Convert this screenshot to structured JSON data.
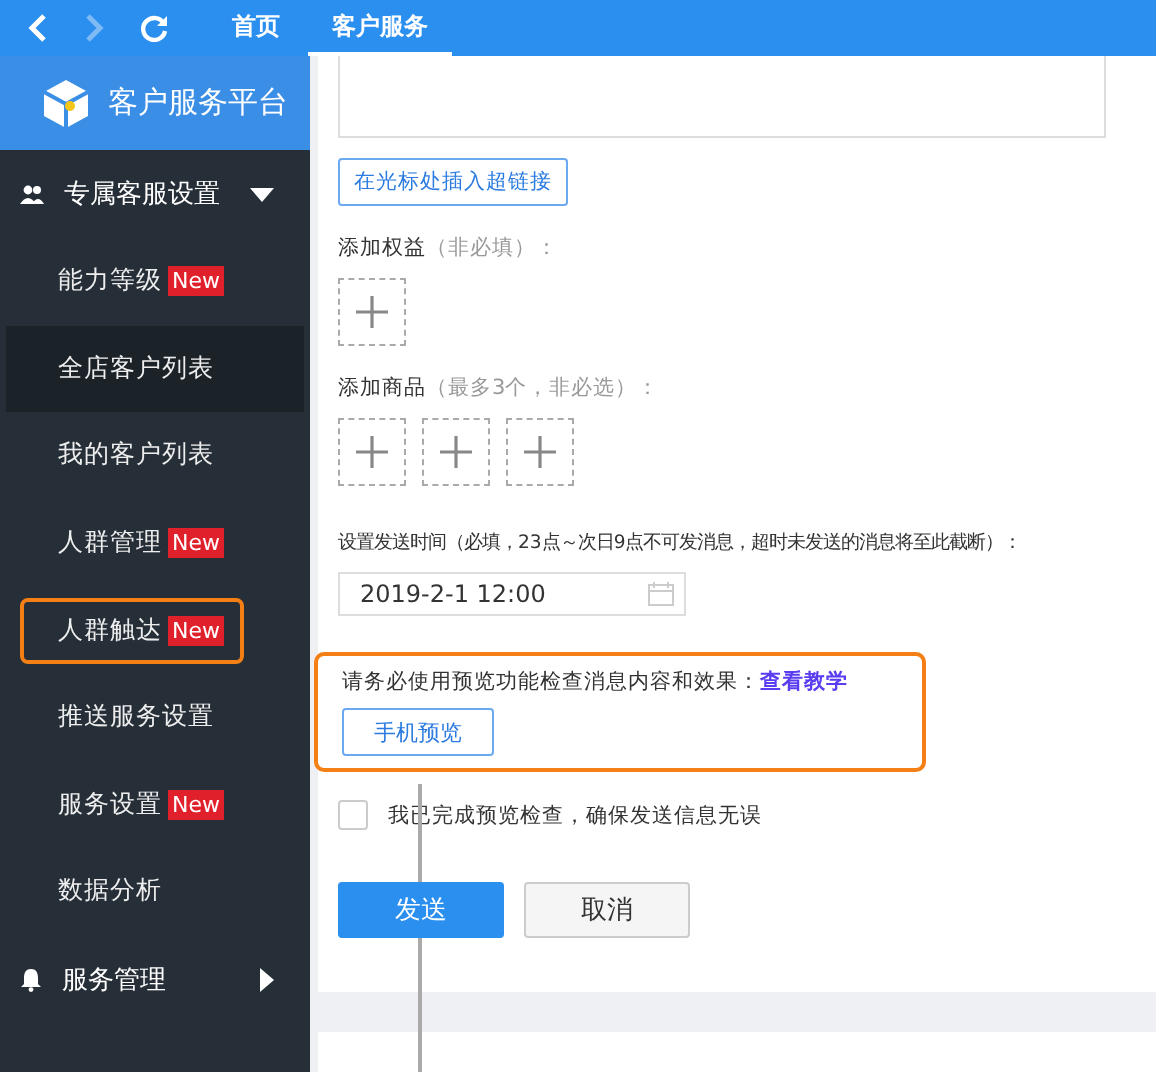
{
  "topbar": {
    "tabs": [
      {
        "label": "首页",
        "selected": false
      },
      {
        "label": "客户服务",
        "selected": true
      }
    ]
  },
  "sidebar": {
    "logo": "客户服务平台",
    "groups": [
      {
        "label": "专属客服设置",
        "expanded": true,
        "items": [
          {
            "label": "能力等级",
            "badge": "New",
            "selected": false,
            "highlighted": false
          },
          {
            "label": "全店客户列表",
            "selected": true,
            "highlighted": false
          },
          {
            "label": "我的客户列表",
            "selected": false,
            "highlighted": false
          },
          {
            "label": "人群管理",
            "badge": "New",
            "selected": false,
            "highlighted": false
          },
          {
            "label": "人群触达",
            "badge": "New",
            "selected": false,
            "highlighted": true
          },
          {
            "label": "推送服务设置",
            "selected": false,
            "highlighted": false
          },
          {
            "label": "服务设置",
            "badge": "New",
            "selected": false,
            "highlighted": false
          },
          {
            "label": "数据分析",
            "selected": false,
            "highlighted": false
          }
        ]
      },
      {
        "label": "服务管理",
        "expanded": false
      }
    ]
  },
  "form": {
    "link_button": "在光标处插入超链接",
    "benefits": {
      "label": "添加权益",
      "hint": "（非必填）："
    },
    "products": {
      "label": "添加商品",
      "hint": "（最多3个，非必选）："
    },
    "send_time": {
      "label": "设置发送时间（必填，23点～次日9点不可发消息，超时未发送的消息将至此截断）：",
      "value": "2019-2-1 12:00"
    },
    "preview": {
      "notice": "请务必使用预览功能检查消息内容和效果：",
      "link": "查看教学",
      "button": "手机预览",
      "highlighted": true
    },
    "confirm": {
      "label": "我已完成预览检查，确保发送信息无误",
      "checked": false
    },
    "buttons": [
      {
        "label": "发送",
        "kind": "primary"
      },
      {
        "label": "取消",
        "kind": "secondary"
      }
    ]
  }
}
